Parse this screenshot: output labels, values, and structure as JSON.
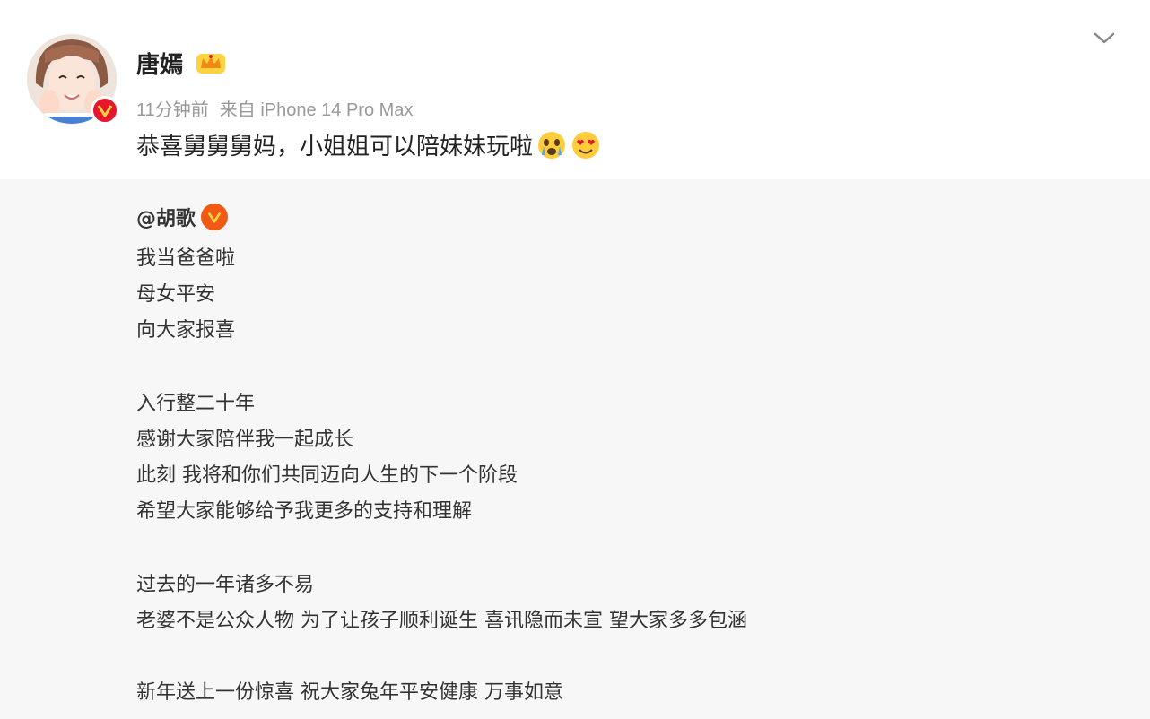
{
  "post": {
    "author": "唐嫣",
    "meta": {
      "time": "11分钟前",
      "source": "来自 iPhone 14 Pro Max"
    },
    "text": "恭喜舅舅舅妈，小姐姐可以陪妹妹玩啦",
    "emojis": [
      "crying-face-emoji",
      "heart-eyes-emoji"
    ]
  },
  "repost": {
    "mention": "@胡歌",
    "lines": [
      "我当爸爸啦",
      "母女平安",
      "向大家报喜",
      "入行整二十年",
      "感谢大家陪伴我一起成长",
      "此刻 我将和你们共同迈向人生的下一个阶段",
      "希望大家能够给予我更多的支持和理解",
      "过去的一年诸多不易",
      "老婆不是公众人物 为了让孩子顺利诞生 喜讯隐而未宣 望大家多多包涵",
      "新年送上一份惊喜 祝大家兔年平安健康 万事如意"
    ]
  },
  "icons": {
    "verified": "verified-v-icon",
    "crown": "crown-vip-icon",
    "menu": "chevron-down-icon"
  },
  "colors": {
    "verified_orange": "#f05a14",
    "meta_gray": "#999999",
    "repost_bg": "#f7f7f7"
  }
}
